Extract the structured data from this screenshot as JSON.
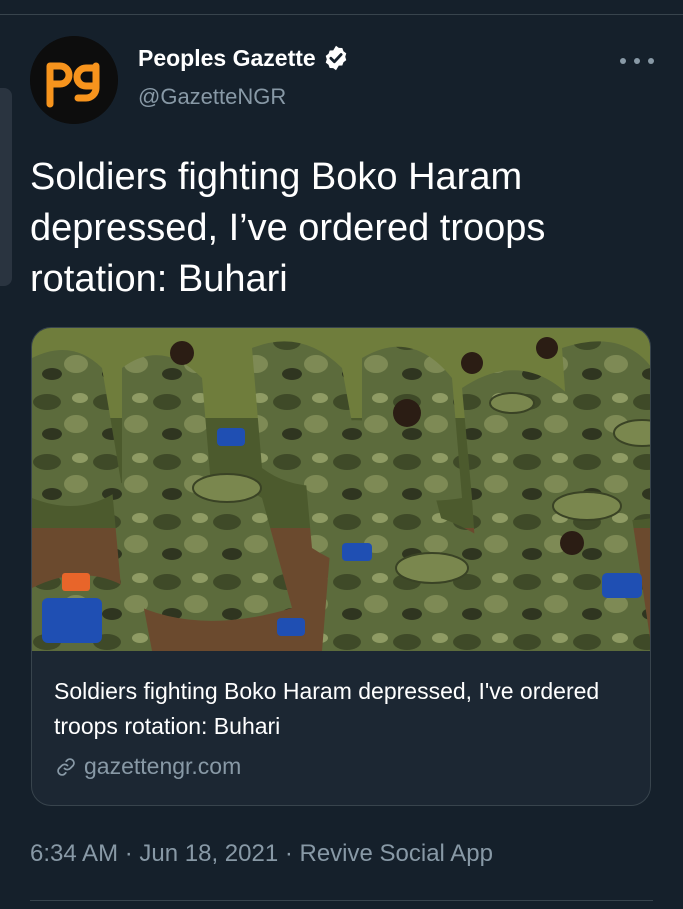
{
  "colors": {
    "background": "#15202b",
    "text_primary": "#ffffff",
    "text_secondary": "#8899a6",
    "border": "#38444d",
    "verified_badge": "#ffffff",
    "brand_logo": "#f7941d"
  },
  "author": {
    "avatar_icon": "peoples-gazette-logo",
    "avatar_logo_text": "pg",
    "display_name": "Peoples Gazette",
    "handle": "@GazetteNGR",
    "verified": true
  },
  "tweet": {
    "text": "Soldiers fighting Boko Haram depressed, I’ve ordered troops rotation: Buhari"
  },
  "link_card": {
    "image_description": "soldiers-photo",
    "title": "Soldiers fighting Boko Haram depressed, I've ordered troops rotation: Buhari",
    "link_icon": "link-icon",
    "domain": "gazettengr.com"
  },
  "meta": {
    "time": "6:34 AM",
    "date": "Jun 18, 2021",
    "source": "Revive Social App",
    "line": "6:34 AM · Jun 18, 2021 · Revive Social App"
  }
}
